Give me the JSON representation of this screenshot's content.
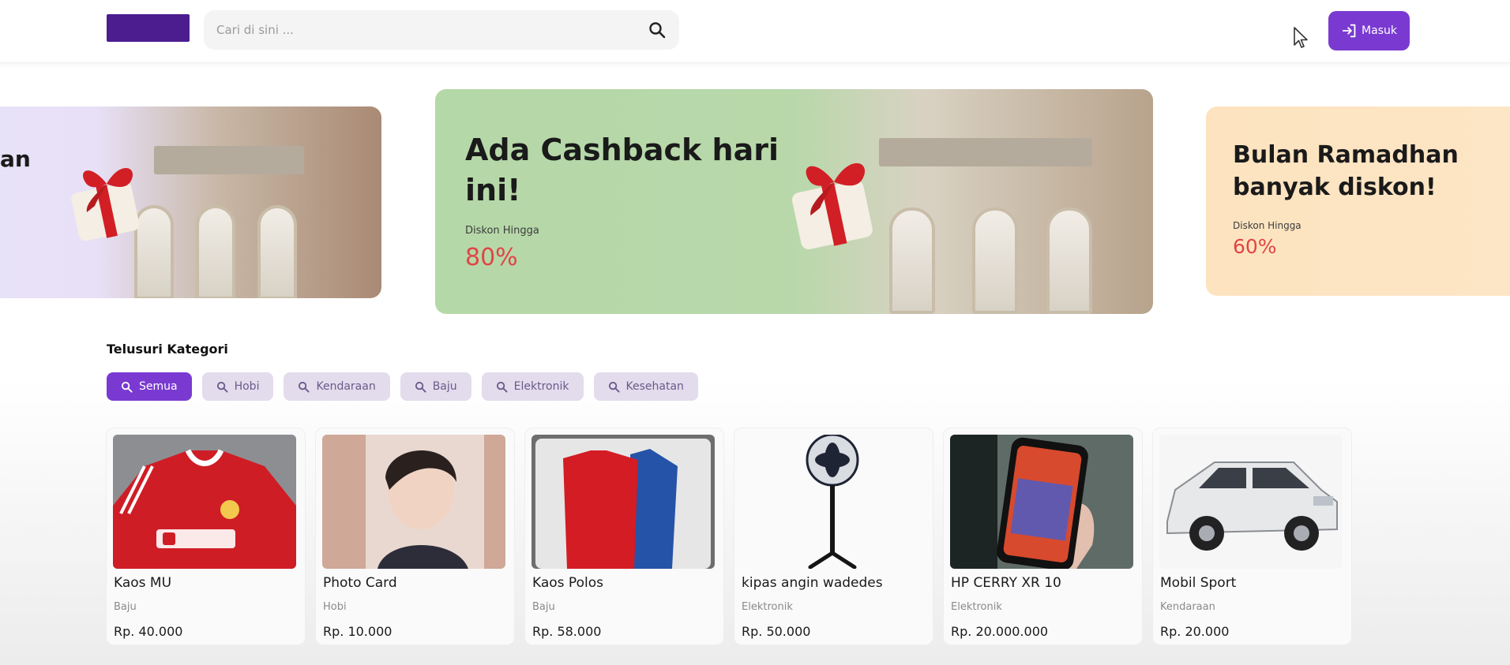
{
  "header": {
    "search_placeholder": "Cari di sini ...",
    "login_label": "Masuk"
  },
  "banners": [
    {
      "title_fragment": "an"
    },
    {
      "title_line1": "Ada Cashback hari",
      "title_line2": "ini!",
      "sub": "Diskon Hingga",
      "percent": "80%"
    },
    {
      "title_line1": "Bulan Ramadhan",
      "title_line2": "banyak diskon!",
      "sub": "Diskon Hingga",
      "percent": "60%"
    }
  ],
  "categories": {
    "title": "Telusuri Kategori",
    "chips": [
      "Semua",
      "Hobi",
      "Kendaraan",
      "Baju",
      "Elektronik",
      "Kesehatan"
    ],
    "active": "Semua"
  },
  "products": [
    {
      "name": "Kaos MU",
      "category": "Baju",
      "price": "Rp. 40.000"
    },
    {
      "name": "Photo Card",
      "category": "Hobi",
      "price": "Rp. 10.000"
    },
    {
      "name": "Kaos Polos",
      "category": "Baju",
      "price": "Rp. 58.000"
    },
    {
      "name": "kipas angin wadedes",
      "category": "Elektronik",
      "price": "Rp. 50.000"
    },
    {
      "name": "HP CERRY XR 10",
      "category": "Elektronik",
      "price": "Rp. 20.000.000"
    },
    {
      "name": "Mobil Sport",
      "category": "Kendaraan",
      "price": "Rp. 20.000"
    }
  ],
  "colors": {
    "brand": "#7a3ad1",
    "logo": "#4b1d8f",
    "discount": "#e04545"
  },
  "icons": [
    "search-icon",
    "login-icon",
    "cursor-icon",
    "gift-icon"
  ]
}
